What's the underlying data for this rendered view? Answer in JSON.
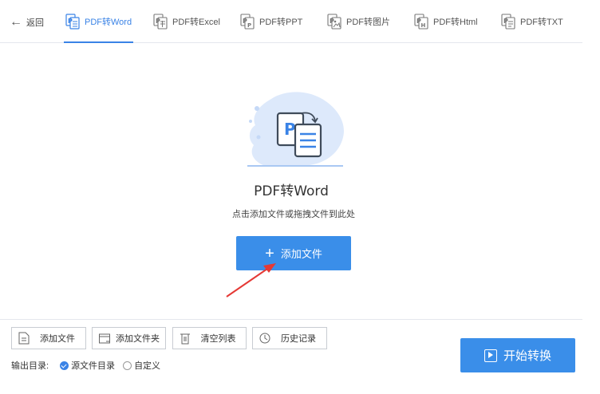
{
  "nav": {
    "back_label": "返回",
    "tabs": [
      {
        "label": "PDF转Word",
        "icon": "pdf-word-icon",
        "active": true
      },
      {
        "label": "PDF转Excel",
        "icon": "pdf-excel-icon",
        "active": false
      },
      {
        "label": "PDF转PPT",
        "icon": "pdf-ppt-icon",
        "active": false
      },
      {
        "label": "PDF转图片",
        "icon": "pdf-image-icon",
        "active": false
      },
      {
        "label": "PDF转Html",
        "icon": "pdf-html-icon",
        "active": false
      },
      {
        "label": "PDF转TXT",
        "icon": "pdf-txt-icon",
        "active": false
      }
    ]
  },
  "main": {
    "title": "PDF转Word",
    "hint": "点击添加文件或拖拽文件到此处",
    "add_button": "添加文件"
  },
  "footer": {
    "buttons": [
      {
        "label": "添加文件",
        "icon": "add-file-icon"
      },
      {
        "label": "添加文件夹",
        "icon": "add-folder-icon"
      },
      {
        "label": "清空列表",
        "icon": "trash-icon"
      },
      {
        "label": "历史记录",
        "icon": "clock-icon"
      }
    ],
    "output_label": "输出目录:",
    "options": [
      {
        "label": "源文件目录",
        "selected": true
      },
      {
        "label": "自定义",
        "selected": false
      }
    ],
    "start_button": "开始转换"
  },
  "colors": {
    "accent": "#3a8ee9",
    "active_tab": "#3a83e6",
    "annotation_arrow": "#e53935"
  }
}
